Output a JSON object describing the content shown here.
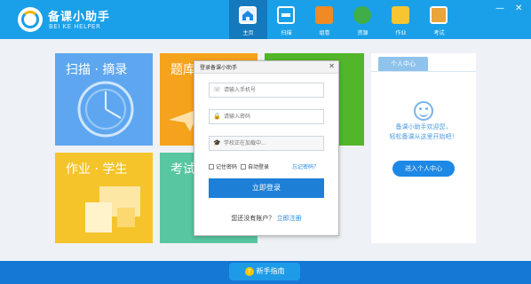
{
  "brand": {
    "title": "备课小助手",
    "subtitle": "BEI KE HELPER"
  },
  "nav": [
    {
      "label": "主页",
      "icon": "home-icon",
      "active": true
    },
    {
      "label": "扫描",
      "icon": "scan-icon"
    },
    {
      "label": "组卷",
      "icon": "compose-icon"
    },
    {
      "label": "资源",
      "icon": "cloud-resource-icon"
    },
    {
      "label": "作业",
      "icon": "homework-icon"
    },
    {
      "label": "考试",
      "icon": "exam-icon"
    }
  ],
  "window_controls": {
    "minimize": "—",
    "close": "✕"
  },
  "tiles": {
    "scan": "扫描 · 摘录",
    "bank": "题库",
    "homework": "作业 · 学生",
    "exam": "考试"
  },
  "personal": {
    "tab": "个人中心",
    "welcome_line1": "备课小助手欢迎您，",
    "welcome_line2": "轻松备课从这里开始吧！",
    "enter_button": "进入个人中心"
  },
  "login": {
    "title": "登录备课小助手",
    "phone_placeholder": "请输入手机号",
    "password_placeholder": "请输入密码",
    "school_placeholder": "学校正在加载中...",
    "remember": "记住密码",
    "auto_login": "自动登录",
    "forgot": "忘记密码？",
    "submit": "立即登录",
    "no_account": "您还没有账户？",
    "register": "立即注册"
  },
  "footer": {
    "guide": "新手指南"
  },
  "colors": {
    "header": "#1aa0e8",
    "accent": "#1e7fd7"
  }
}
